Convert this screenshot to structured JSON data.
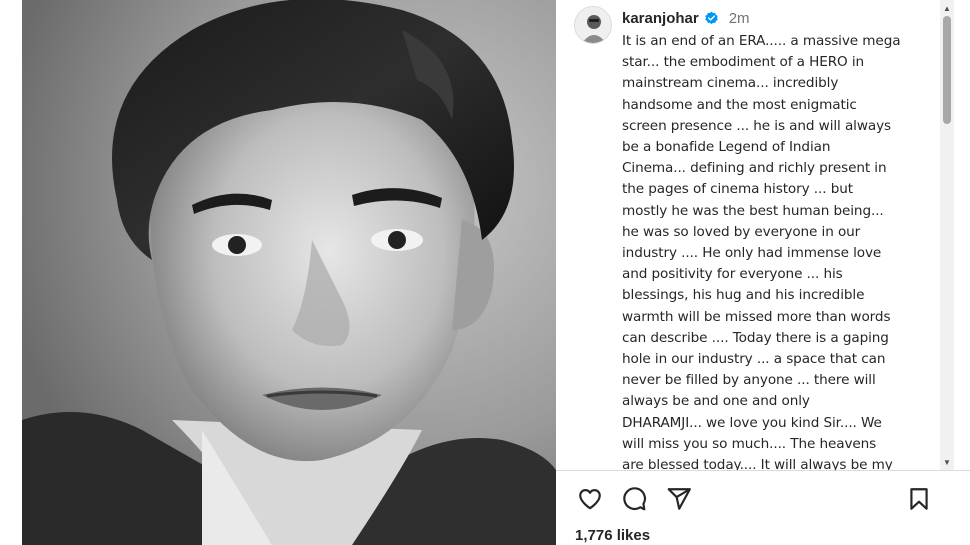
{
  "post": {
    "username": "karanjohar",
    "verified": true,
    "verified_icon": "verified-badge-icon",
    "timestamp": "2m",
    "caption": "It is an end of an ERA..... a massive mega\nstar... the embodiment of a HERO in\nmainstream cinema... incredibly\nhandsome and the most  enigmatic\nscreen presence ... he is and will always\nbe a bonafide Legend of Indian\nCinema... defining and richly present in\nthe pages of cinema history ... but\nmostly he was the best human being...\nhe was so loved by everyone in our\nindustry .... He only had immense love\nand positivity for everyone ... his\nblessings, his hug and his incredible\nwarmth will be missed more than words\ncan describe .... Today there is a gaping\nhole in our industry ... a space that can\nnever be filled by anyone ... there will\nalways be and one and only\nDHARAMJI... we love you kind Sir.... We\nwill miss you so much.... The heavens\nare blessed today.... It will always be my",
    "likes": "1,776 likes"
  },
  "actions": {
    "like_icon": "heart-icon",
    "comment_icon": "comment-icon",
    "share_icon": "send-icon",
    "save_icon": "bookmark-icon"
  },
  "colors": {
    "text": "#262626",
    "secondary_text": "#737373",
    "verified_blue": "#0095f6",
    "divider": "#dbdbdb"
  }
}
